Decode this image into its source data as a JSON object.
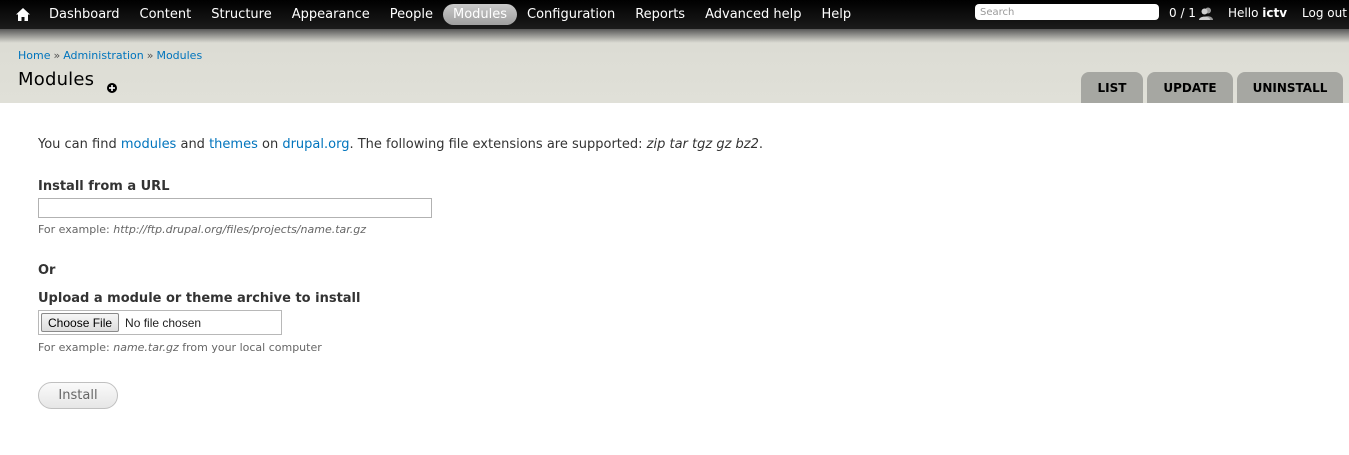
{
  "toolbar": {
    "nav": [
      "Dashboard",
      "Content",
      "Structure",
      "Appearance",
      "People",
      "Modules",
      "Configuration",
      "Reports",
      "Advanced help",
      "Help"
    ],
    "active": "Modules",
    "search_placeholder": "Search",
    "counter": "0 / 1",
    "hello_prefix": "Hello",
    "username": "ictv",
    "logout": "Log out"
  },
  "breadcrumb": {
    "items": [
      "Home",
      "Administration",
      "Modules"
    ],
    "separator": "»"
  },
  "page": {
    "title": "Modules",
    "tabs": [
      "List",
      "Update",
      "Uninstall"
    ]
  },
  "form": {
    "intro": {
      "t1": "You can find ",
      "link1": "modules",
      "t2": " and ",
      "link2": "themes",
      "t3": " on ",
      "link3": "drupal.org",
      "t4": ". The following file extensions are supported: ",
      "extensions": "zip tar tgz gz bz2",
      "t5": "."
    },
    "url_label": "Install from a URL",
    "url_value": "",
    "url_desc_prefix": "For example: ",
    "url_example": "http://ftp.drupal.org/files/projects/name.tar.gz",
    "or_label": "Or",
    "upload_label": "Upload a module or theme archive to install",
    "choose_file": "Choose File",
    "file_status": "No file chosen",
    "upload_desc_prefix": "For example: ",
    "upload_example": "name.tar.gz",
    "upload_desc_suffix": " from your local computer",
    "install_button": "Install"
  },
  "colors": {
    "toolbar_bg": "#000000",
    "header_bg": "#e0e0d8",
    "link": "#0074bd",
    "tab_bg": "#a6a7a2"
  }
}
